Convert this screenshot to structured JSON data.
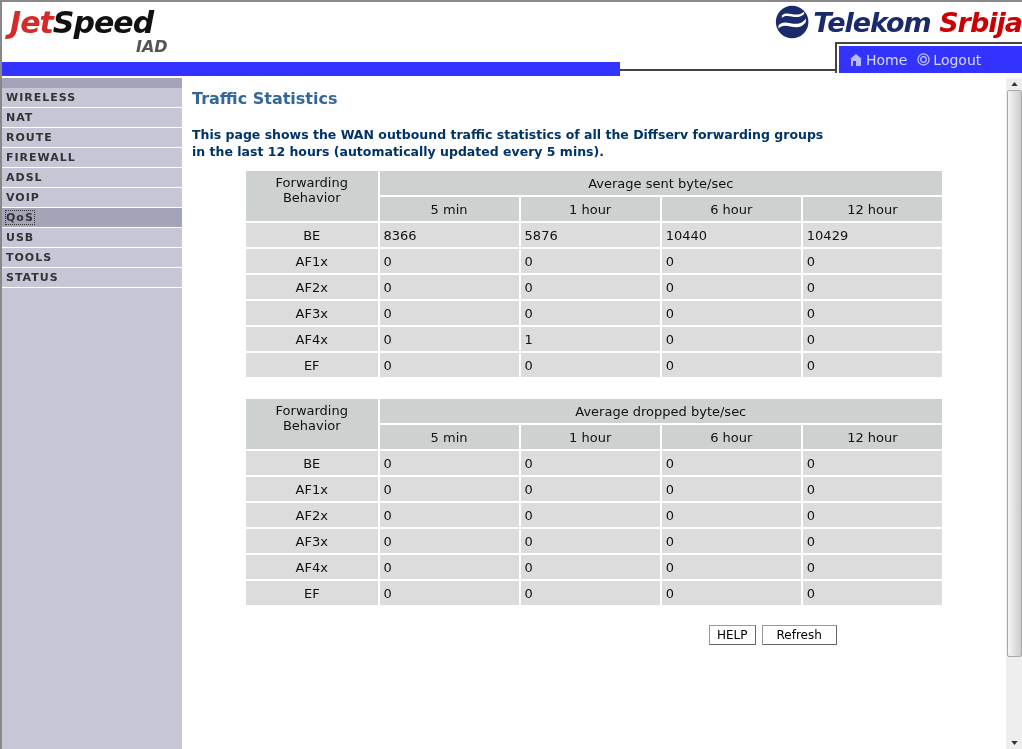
{
  "header": {
    "logo_parts": [
      "Jet",
      "Speed"
    ],
    "logo_sub": "IAD",
    "brand_parts": [
      "Telekom",
      "Srbija"
    ]
  },
  "nav_links": [
    {
      "label": "Home",
      "kind": "home"
    },
    {
      "label": "Logout",
      "kind": "logout"
    }
  ],
  "sidebar": {
    "items": [
      {
        "label": "WIRELESS",
        "selected": false
      },
      {
        "label": "NAT",
        "selected": false
      },
      {
        "label": "ROUTE",
        "selected": false
      },
      {
        "label": "FIREWALL",
        "selected": false
      },
      {
        "label": "ADSL",
        "selected": false
      },
      {
        "label": "VOIP",
        "selected": false
      },
      {
        "label": "QoS",
        "selected": true
      },
      {
        "label": "USB",
        "selected": false
      },
      {
        "label": "TOOLS",
        "selected": false
      },
      {
        "label": "STATUS",
        "selected": false
      }
    ]
  },
  "page_title": "Traffic Statistics",
  "description": "This page shows the WAN outbound traffic statistics of all the Diffserv forwarding groups in the last 12 hours (automatically updated every 5 mins).",
  "tables": [
    {
      "row_header": "Forwarding Behavior",
      "group_header": "Average sent byte/sec",
      "columns": [
        "5 min",
        "1 hour",
        "6 hour",
        "12 hour"
      ],
      "rows": [
        {
          "label": "BE",
          "cells": [
            "8366",
            "5876",
            "10440",
            "10429"
          ]
        },
        {
          "label": "AF1x",
          "cells": [
            "0",
            "0",
            "0",
            "0"
          ]
        },
        {
          "label": "AF2x",
          "cells": [
            "0",
            "0",
            "0",
            "0"
          ]
        },
        {
          "label": "AF3x",
          "cells": [
            "0",
            "0",
            "0",
            "0"
          ]
        },
        {
          "label": "AF4x",
          "cells": [
            "0",
            "1",
            "0",
            "0"
          ]
        },
        {
          "label": "EF",
          "cells": [
            "0",
            "0",
            "0",
            "0"
          ]
        }
      ]
    },
    {
      "row_header": "Forwarding Behavior",
      "group_header": "Average dropped byte/sec",
      "columns": [
        "5 min",
        "1 hour",
        "6 hour",
        "12 hour"
      ],
      "rows": [
        {
          "label": "BE",
          "cells": [
            "0",
            "0",
            "0",
            "0"
          ]
        },
        {
          "label": "AF1x",
          "cells": [
            "0",
            "0",
            "0",
            "0"
          ]
        },
        {
          "label": "AF2x",
          "cells": [
            "0",
            "0",
            "0",
            "0"
          ]
        },
        {
          "label": "AF3x",
          "cells": [
            "0",
            "0",
            "0",
            "0"
          ]
        },
        {
          "label": "AF4x",
          "cells": [
            "0",
            "0",
            "0",
            "0"
          ]
        },
        {
          "label": "EF",
          "cells": [
            "0",
            "0",
            "0",
            "0"
          ]
        }
      ]
    }
  ],
  "buttons": [
    "HELP",
    "Refresh"
  ]
}
